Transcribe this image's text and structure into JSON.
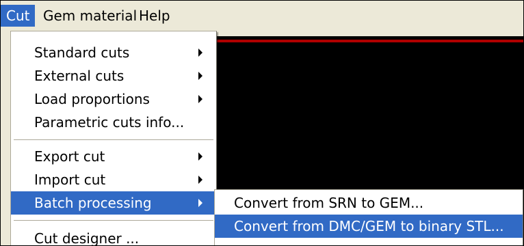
{
  "menubar": {
    "items": [
      {
        "label": "Cut"
      },
      {
        "label": "Gem material"
      },
      {
        "label": "Help"
      }
    ]
  },
  "cut_menu": {
    "items": [
      {
        "label": "Standard cuts",
        "submenu": true
      },
      {
        "label": "External cuts",
        "submenu": true
      },
      {
        "label": "Load proportions",
        "submenu": true
      },
      {
        "label": "Parametric cuts info...",
        "submenu": false
      },
      {
        "label": "Export cut",
        "submenu": true
      },
      {
        "label": "Import cut",
        "submenu": true
      },
      {
        "label": "Batch processing",
        "submenu": true
      },
      {
        "label": "Cut designer ...",
        "submenu": false
      }
    ]
  },
  "batch_submenu": {
    "items": [
      {
        "label": "Convert from SRN to GEM..."
      },
      {
        "label": "Convert from DMC/GEM to binary STL..."
      }
    ]
  },
  "colors": {
    "highlight": "#316ac5",
    "menubar_bg": "#ece9d8",
    "menu_bg": "#ffffff",
    "viewport_bg": "#000000",
    "viewport_line": "#b00000"
  }
}
